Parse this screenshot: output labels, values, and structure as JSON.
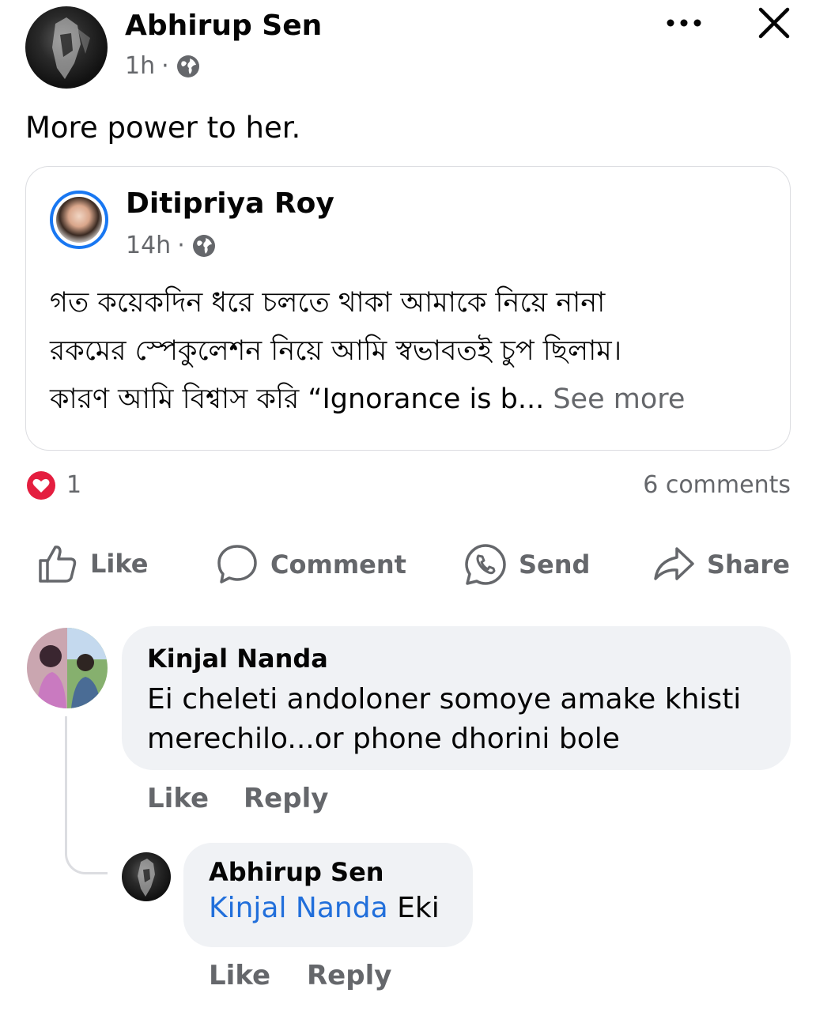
{
  "post": {
    "author": "Abhirup Sen",
    "time": "1h",
    "separator": "·",
    "text": "More power to her.",
    "menu_icon": "more-horizontal-icon",
    "close_icon": "close-icon"
  },
  "shared_post": {
    "author": "Ditipriya Roy",
    "time": "14h",
    "separator": "·",
    "lines": [
      "গত কয়েকদিন ধরে চলতে থাকা আমাকে নিয়ে নানা",
      "রকমের স্পেকুলেশন নিয়ে আমি স্বভাবতই চুপ ছিলাম।",
      "কারণ আমি  বিশ্বাস করি “Ignorance is b..."
    ],
    "see_more": "See more"
  },
  "stats": {
    "reactions_count": "1",
    "comments": "6 comments",
    "reaction_color": "#e41e3f"
  },
  "actions": {
    "like": "Like",
    "comment": "Comment",
    "send": "Send",
    "share": "Share"
  },
  "comments": [
    {
      "author": "Kinjal Nanda",
      "text": "Ei cheleti andoloner somoye amake khisti merechilo...or phone dhorini bole",
      "like": "Like",
      "reply": "Reply"
    }
  ],
  "replies": [
    {
      "author": "Abhirup Sen",
      "mention": "Kinjal Nanda",
      "text": " Eki",
      "like": "Like",
      "reply": "Reply"
    }
  ],
  "colors": {
    "link": "#216fdb",
    "secondary_text": "#65676b",
    "bubble": "#f0f2f5"
  }
}
